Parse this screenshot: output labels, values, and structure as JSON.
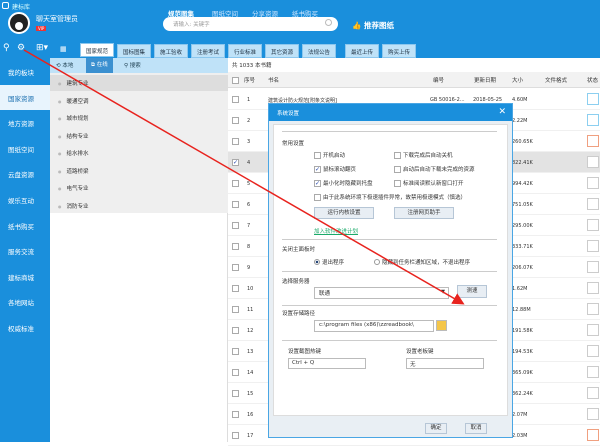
{
  "app": {
    "title": "建标库",
    "username": "聊天室管理员",
    "vip": "VIP"
  },
  "topnav": [
    "规范图集",
    "图纸空间",
    "分享资源",
    "纸书购买"
  ],
  "search": {
    "placeholder": "请输入: 关键字"
  },
  "recommend": "推荐图纸",
  "tabs": [
    "国家规范",
    "国标图集",
    "施工验收",
    "注册考试",
    "行业标准",
    "其它资源",
    "法规公告",
    "最近上传",
    "购买上传"
  ],
  "sidebar": [
    "我的板块",
    "国家资源",
    "地方资源",
    "图纸空间",
    "云盘资源",
    "娱乐互动",
    "纸书购买",
    "服务交流",
    "建标商城",
    "各地网站",
    "权威标准"
  ],
  "cat_tabs": [
    "本地",
    "在线",
    "搜索"
  ],
  "categories": [
    "建筑专业",
    "暖通空调",
    "城市规划",
    "结构专业",
    "给水排水",
    "道路桥梁",
    "电气专业",
    "消防专业"
  ],
  "table": {
    "count": "共 1033 本书籍",
    "columns": [
      "序号",
      "书名",
      "编号",
      "更新日期",
      "大小",
      "文件格式",
      "状态"
    ],
    "rows": [
      {
        "n": "1",
        "title": "建筑设计防火规范[附条文说明]",
        "code": "GB 50016-2...",
        "date": "2018-05-25",
        "size": "4.60M",
        "checked": false,
        "status": "#8ccff0"
      },
      {
        "n": "2",
        "title": "阝",
        "size": "2.22M",
        "checked": false,
        "status": "#8ccff0"
      },
      {
        "n": "3",
        "title": "乜",
        "size": "260.65K",
        "checked": false,
        "status": "#f0a080",
        "red": true
      },
      {
        "n": "4",
        "title": "产",
        "size": "822.41K",
        "checked": true,
        "status": "#ccc"
      },
      {
        "n": "5",
        "title": "车",
        "size": "994.42K",
        "checked": false,
        "status": "#ccc"
      },
      {
        "n": "6",
        "title": "关",
        "size": "751.05K",
        "checked": false,
        "status": "#ccc"
      },
      {
        "n": "7",
        "title": "扌",
        "size": "295.00K",
        "checked": false,
        "status": "#ccc"
      },
      {
        "n": "8",
        "title": "仁",
        "size": "333.71K",
        "checked": false,
        "status": "#ccc"
      },
      {
        "n": "9",
        "title": "它",
        "size": "206.07K",
        "checked": false,
        "status": "#ccc"
      },
      {
        "n": "10",
        "title": "电",
        "size": "1.62M",
        "checked": false,
        "status": "#ccc"
      },
      {
        "n": "11",
        "title": "汉",
        "size": "12.88M",
        "checked": false,
        "status": "#ccc"
      },
      {
        "n": "12",
        "title": "建",
        "size": "191.58K",
        "checked": false,
        "status": "#ccc"
      },
      {
        "n": "13",
        "title": "具",
        "size": "194.53K",
        "checked": false,
        "status": "#ccc"
      },
      {
        "n": "14",
        "title": "查",
        "size": "365.09K",
        "checked": false,
        "status": "#ccc"
      },
      {
        "n": "15",
        "title": "建",
        "size": "362.24K",
        "checked": false,
        "status": "#ccc"
      },
      {
        "n": "16",
        "title": "公",
        "size": "2.07M",
        "checked": false,
        "status": "#ccc"
      },
      {
        "n": "17",
        "title": "人",
        "size": "2.03M",
        "checked": false,
        "status": "#f0a080",
        "red": true
      }
    ]
  },
  "dialog": {
    "title": "系统设置",
    "general": "常用设置",
    "options": [
      {
        "label": "开机启动",
        "checked": false
      },
      {
        "label": "下载完成后自动关机",
        "checked": false
      },
      {
        "label": "鼠标滚动翻页",
        "checked": true
      },
      {
        "label": "启动后自动下载未完成的资源",
        "checked": false
      },
      {
        "label": "最小化时隐藏到托盘",
        "checked": true
      },
      {
        "label": "标准阅读默认新窗口打开",
        "checked": false
      },
      {
        "label": "由于此系统环境下极速插件异常，故禁用极速模式（慎选）",
        "checked": false
      }
    ],
    "kernel_btn": "运行内核设置",
    "register_btn": "注册网页助手",
    "join_link": "加入软件改进计划",
    "close_section": "关闭主面板时",
    "radio_exit": "退出程序",
    "radio_tray": "隐藏到任务栏通知区域，不退出程序",
    "server_section": "选择服务器",
    "server_value": "联通",
    "speed_btn": "测速",
    "path_section": "设置存储路径",
    "path_value": "c:\\program files (x86)\\zzreadbook\\",
    "hotkey_label": "设置截图热键",
    "hotkey_value": "Ctrl + Q",
    "boss_label": "设置老板键",
    "boss_value": "无",
    "ok": "确定",
    "cancel": "取消"
  }
}
